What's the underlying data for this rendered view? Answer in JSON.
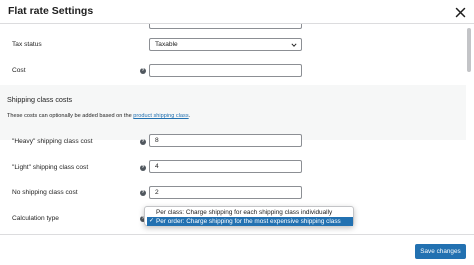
{
  "modal": {
    "title": "Flat rate Settings"
  },
  "fields": {
    "tax_status": {
      "label": "Tax status",
      "value": "Taxable"
    },
    "cost": {
      "label": "Cost",
      "value": ""
    }
  },
  "shipping_class_costs": {
    "title": "Shipping class costs",
    "description_prefix": "These costs can optionally be added based on the",
    "link_text": "product shipping class",
    "description_suffix": ".",
    "heavy": {
      "label": "\"Heavy\" shipping class cost",
      "value": "8"
    },
    "light": {
      "label": "\"Light\" shipping class cost",
      "value": "4"
    },
    "none": {
      "label": "No shipping class cost",
      "value": "2"
    },
    "calculation_type": {
      "label": "Calculation type",
      "options": [
        {
          "label": "Per class: Charge shipping for each shipping class individually",
          "selected": false
        },
        {
          "label": "Per order: Charge shipping for the most expensive shipping class",
          "selected": true
        }
      ]
    }
  },
  "footer": {
    "save_label": "Save changes"
  },
  "colors": {
    "accent": "#2271b1",
    "section_bg": "#f6f7f7"
  }
}
